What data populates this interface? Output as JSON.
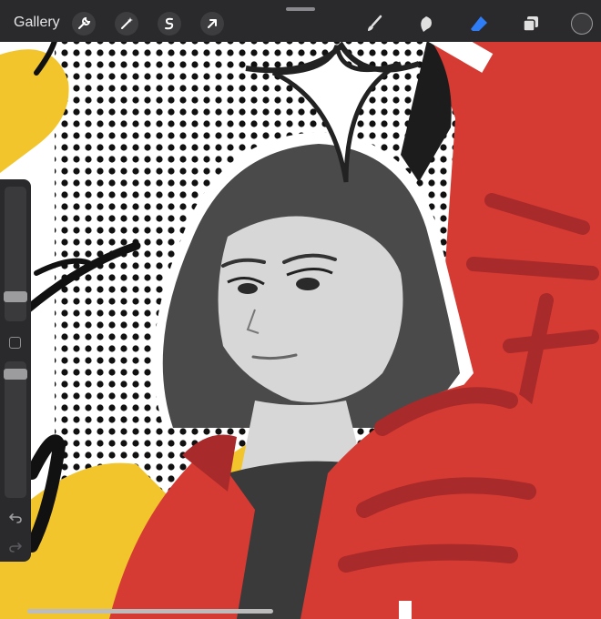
{
  "toolbar": {
    "gallery_label": "Gallery",
    "left_tools": [
      "wrench-icon",
      "magic-wand-icon",
      "selection-icon",
      "transform-arrow-icon"
    ],
    "right_tools": [
      "brush-icon",
      "smudge-icon",
      "eraser-icon",
      "layers-icon"
    ],
    "active_tool": "eraser-icon",
    "accent_color": "#2f7df6",
    "current_color": "#3a3a3c"
  },
  "sidebar": {
    "brush_size_level": 0.14,
    "opacity_level": 0.96,
    "icons": [
      "modify-square-icon",
      "undo-icon",
      "redo-icon"
    ]
  },
  "artwork": {
    "colors": {
      "red": "#d63b33",
      "dark_red": "#a82a2a",
      "yellow": "#f2c52c",
      "gray": "#4a4a4a",
      "skin": "#d7d7d7"
    }
  }
}
